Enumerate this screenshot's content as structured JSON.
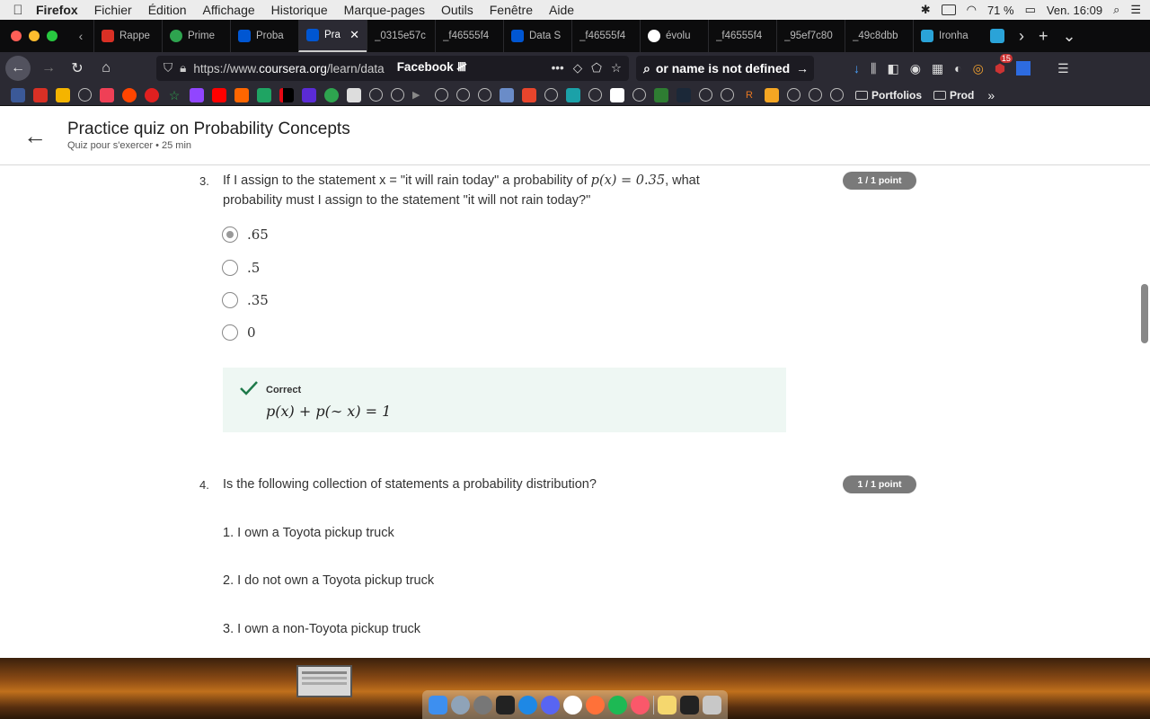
{
  "menubar": {
    "app": "Firefox",
    "items": [
      "Fichier",
      "Édition",
      "Affichage",
      "Historique",
      "Marque-pages",
      "Outils",
      "Fenêtre",
      "Aide"
    ],
    "battery": "71 %",
    "clock": "Ven. 16:09"
  },
  "tabs": [
    {
      "label": "Rappe",
      "color": "#d93025"
    },
    {
      "label": "Prime",
      "color": "#2ea44f"
    },
    {
      "label": "Proba",
      "color": "#0056d2"
    },
    {
      "label": "Pra",
      "color": "#0056d2"
    },
    {
      "label": "_0315e57c",
      "color": "#0c0c0d"
    },
    {
      "label": "_f46555f4",
      "color": "#0c0c0d"
    },
    {
      "label": "Data S",
      "color": "#0056d2"
    },
    {
      "label": "_f46555f4",
      "color": "#0c0c0d"
    },
    {
      "label": "évolu",
      "color": "#ffffff"
    },
    {
      "label": "_f46555f4",
      "color": "#0c0c0d"
    },
    {
      "label": "_95ef7c80",
      "color": "#0c0c0d"
    },
    {
      "label": "_49c8dbb",
      "color": "#0c0c0d"
    },
    {
      "label": "Ironha",
      "color": "#2aa3d8"
    }
  ],
  "navbar": {
    "url_prefix": "https://www.",
    "url_domain": "coursera.org",
    "url_path": "/learn/data",
    "url_suffix": "Facebook 𝍸",
    "search_text": "or name is not defined",
    "badge": "15"
  },
  "bookmarks": {
    "folders": [
      "Portfolios",
      "Prod"
    ]
  },
  "header": {
    "title": "Practice quiz on Probability Concepts",
    "subtitle": "Quiz pour s'exercer • 25  min"
  },
  "question3": {
    "number": "3.",
    "text_before": "If I assign to the statement x = \"it will rain today\" a probability of ",
    "math": "p(x) = 0.35",
    "text_after": ", what probability must I assign to the statement \"it will not rain today?\"",
    "points": "1 / 1 point",
    "options": [
      {
        "label": ".65",
        "selected": true
      },
      {
        "label": ".5",
        "selected": false
      },
      {
        "label": ".35",
        "selected": false
      },
      {
        "label": "0",
        "selected": false
      }
    ],
    "feedback_label": "Correct",
    "feedback_eq": "p(x) + p(∼ x) = 1"
  },
  "question4": {
    "number": "4.",
    "text": "Is the following collection of statements a probability distribution?",
    "points": "1 / 1 point",
    "statements": [
      "1. I own a Toyota pickup truck",
      "2. I do not own a Toyota pickup truck",
      "3. I own a non-Toyota pickup truck"
    ]
  },
  "colors": {
    "correct_green": "#1e7a4a",
    "pill_gray": "#7a7a7a",
    "correct_bg": "#eef7f3"
  }
}
